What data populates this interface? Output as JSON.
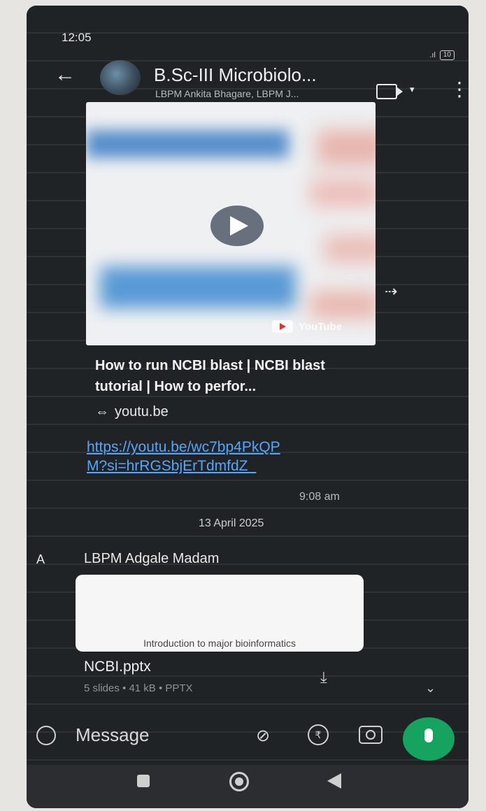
{
  "status": {
    "time": "12:05",
    "battery": "10"
  },
  "header": {
    "title": "B.Sc-III Microbiolo...",
    "subtitle": "LBPM Ankita Bhagare, LBPM J..."
  },
  "link_message": {
    "video_brand": "YouTube",
    "title": "How to run NCBI blast | NCBI blast tutorial | How to perfor...",
    "domain": "youtu.be",
    "url": "https://youtu.be/wc7bp4PkQPM?si=hrRGSbjErTdmfdZ_",
    "time": "9:08 am"
  },
  "date_chip": "13 April 2025",
  "doc_message": {
    "sender_initial": "A",
    "sender_name": "LBPM Adgale Madam",
    "preview_text": "Introduction to major bioinformatics",
    "file_name": "NCBI.pptx",
    "file_meta": "5 slides • 41 kB • PPTX"
  },
  "input": {
    "placeholder": "Message"
  },
  "icons": {
    "back": "arrow-left-icon",
    "video_call": "video-camera-icon",
    "menu": "more-vertical-icon",
    "forward": "forward-icon",
    "download": "download-icon",
    "emoji": "emoji-icon",
    "attach": "paperclip-icon",
    "payment": "rupee-icon",
    "camera": "camera-icon",
    "mic": "microphone-icon"
  },
  "colors": {
    "accent_green": "#15a35f",
    "link_blue": "#55a6ff",
    "background": "#202325"
  }
}
